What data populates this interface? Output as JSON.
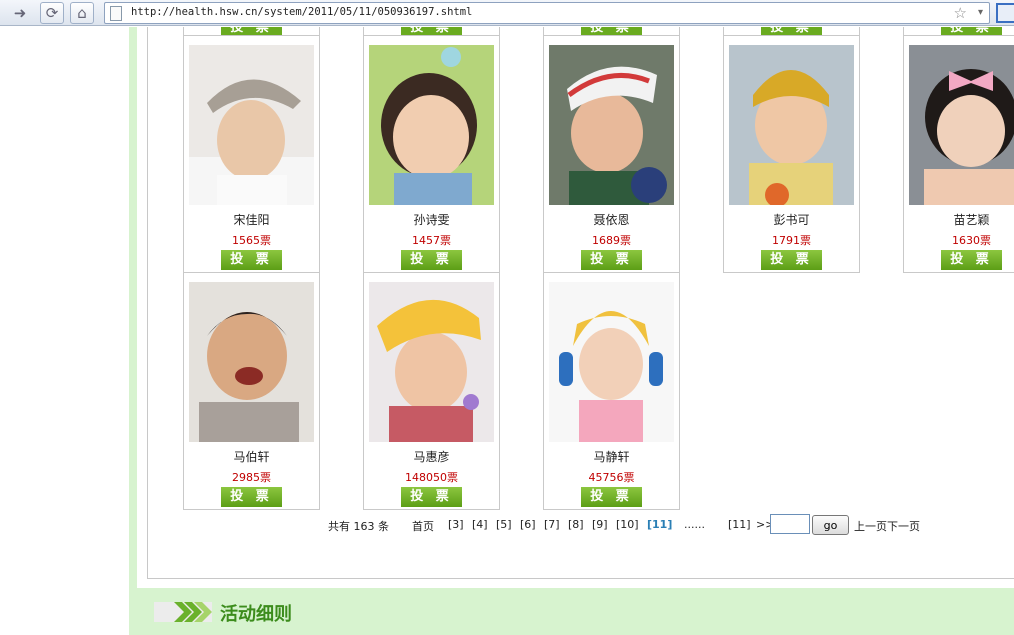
{
  "browser": {
    "url": "http://health.hsw.cn/system/2011/05/11/050936197.shtml"
  },
  "cards": [
    {
      "name": "宋佳阳",
      "votes": "1565票",
      "vote_label": "投 票"
    },
    {
      "name": "孙诗雯",
      "votes": "1457票",
      "vote_label": "投 票"
    },
    {
      "name": "聂依恩",
      "votes": "1689票",
      "vote_label": "投 票"
    },
    {
      "name": "彭书可",
      "votes": "1791票",
      "vote_label": "投 票"
    },
    {
      "name": "苗艺颖",
      "votes": "1630票",
      "vote_label": "投 票"
    },
    {
      "name": "马伯轩",
      "votes": "2985票",
      "vote_label": "投 票"
    },
    {
      "name": "马惠彦",
      "votes": "148050票",
      "vote_label": "投 票"
    },
    {
      "name": "马静轩",
      "votes": "45756票",
      "vote_label": "投 票"
    }
  ],
  "top_vote_label": "投 票",
  "pagination": {
    "total": "共有 163 条",
    "first": "首页",
    "pages": [
      "[3]",
      "[4]",
      "[5]",
      "[6]",
      "[7]",
      "[8]",
      "[9]",
      "[10]"
    ],
    "current": "[11]",
    "ellipsis": "......",
    "last": "[11]",
    "next_arrow": ">>",
    "go_label": "go",
    "prev_next": "上一页下一页"
  },
  "rules": {
    "title": "活动细则"
  },
  "colors": {
    "accent_green": "#6aab20",
    "vote_red": "#c00000",
    "rail_green": "#d7f3cf"
  }
}
